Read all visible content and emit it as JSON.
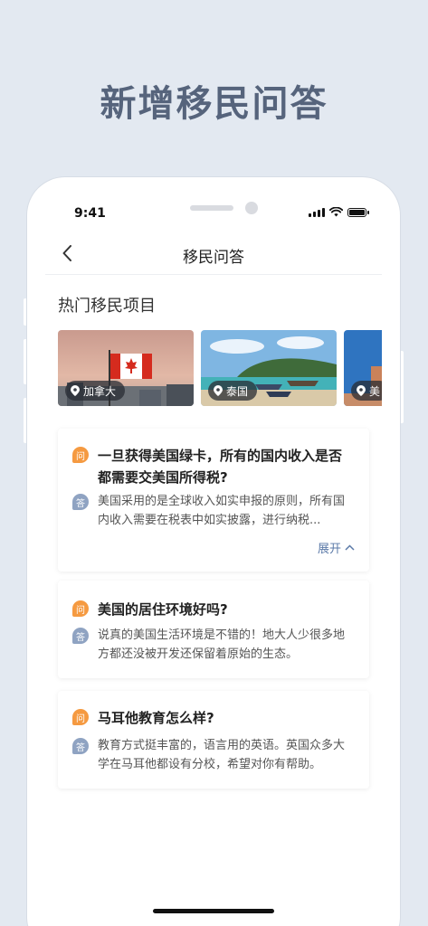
{
  "headline": "新增移民问答",
  "status_bar": {
    "time": "9:41"
  },
  "navbar": {
    "title": "移民问答"
  },
  "section": {
    "title": "热门移民项目"
  },
  "projects": [
    {
      "location": "加拿大"
    },
    {
      "location": "泰国"
    },
    {
      "location": "美"
    }
  ],
  "qa": [
    {
      "q_icon": "问",
      "question": "一旦获得美国绿卡，所有的国内收入是否都需要交美国所得税?",
      "a_icon": "答",
      "answer": "美国采用的是全球收入如实申报的原则，所有国内收入需要在税表中如实披露，进行纳税...",
      "expand_label": "展开"
    },
    {
      "q_icon": "问",
      "question": "美国的居住环境好吗?",
      "a_icon": "答",
      "answer": "说真的美国生活环境是不错的！地大人少很多地方都还没被开发还保留着原始的生态。"
    },
    {
      "q_icon": "问",
      "question": "马耳他教育怎么样?",
      "a_icon": "答",
      "answer": "教育方式挺丰富的，语言用的英语。英国众多大学在马耳他都设有分校，希望对你有帮助。"
    }
  ],
  "colors": {
    "accent_orange": "#f59a41",
    "answer_badge": "#8fa3c2",
    "link_blue": "#5b7aa8"
  }
}
